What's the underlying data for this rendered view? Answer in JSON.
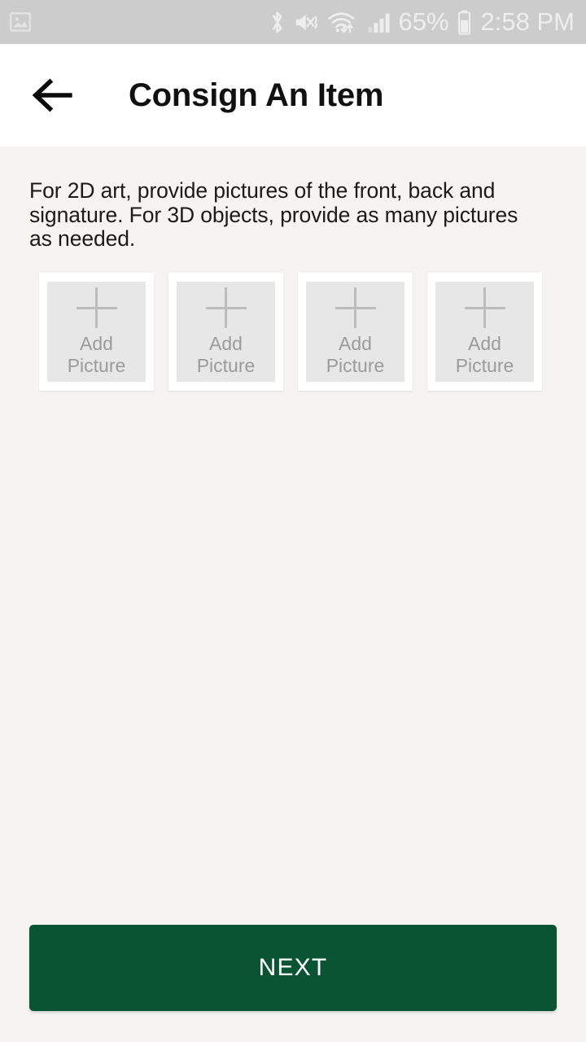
{
  "status_bar": {
    "background_color": "#cccccc",
    "icon_color": "#eeeeee",
    "notification_icons": [
      {
        "name": "gallery-photo-icon"
      }
    ],
    "system_icons": [
      {
        "name": "bluetooth-icon"
      },
      {
        "name": "sound-mute-vibrate-icon"
      },
      {
        "name": "wifi-transfer-icon"
      },
      {
        "name": "cellular-signal-icon"
      }
    ],
    "battery_percent": "65%",
    "battery_icon": "battery-icon",
    "time": "2:58 PM"
  },
  "appbar": {
    "back_icon": "back-arrow-icon",
    "title": "Consign An Item",
    "background_color": "#ffffff",
    "title_color": "#111111"
  },
  "content": {
    "background_color": "#f5f4f0",
    "instructions": "For 2D art, provide pictures of the front, back and signature. For 3D objects, provide as many pictures as needed.",
    "tiles": [
      {
        "icon": "plus-icon",
        "label": "Add\nPicture",
        "label_line1": "Add",
        "label_line2": "Picture"
      },
      {
        "icon": "plus-icon",
        "label": "Add\nPicture",
        "label_line1": "Add",
        "label_line2": "Picture"
      },
      {
        "icon": "plus-icon",
        "label": "Add\nPicture",
        "label_line1": "Add",
        "label_line2": "Picture"
      },
      {
        "icon": "plus-icon",
        "label": "Add\nPicture",
        "label_line1": "Add",
        "label_line2": "Picture"
      }
    ],
    "tile_count": 4
  },
  "footer": {
    "next_label": "NEXT",
    "next_color": "#0a5434",
    "next_text_color": "#ffffff"
  }
}
